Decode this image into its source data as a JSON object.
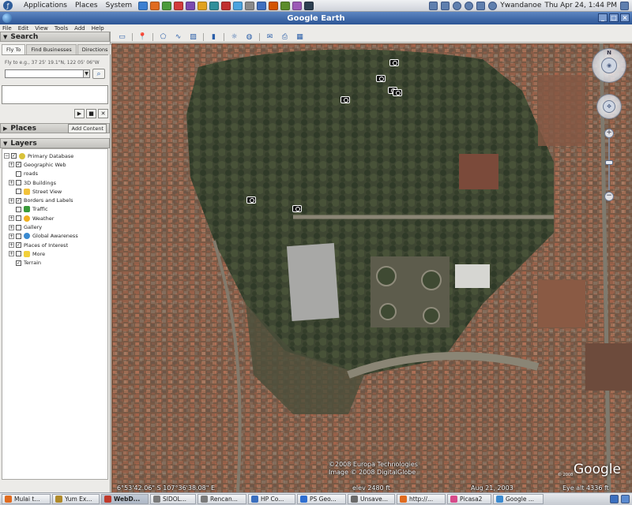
{
  "top_panel": {
    "menus": [
      "Applications",
      "Places",
      "System"
    ],
    "user": "Ywandanoe",
    "clock": "Thu Apr 24,  1:44 PM",
    "launcher_colors": [
      "#3b7fd1",
      "#e06b1f",
      "#4a9a3a",
      "#d13b3b",
      "#7a4ab0",
      "#e0a21f",
      "#2f8f9a",
      "#c03030",
      "#4aa3df",
      "#8a8a8a",
      "#3f6fbf",
      "#d35400",
      "#5b8c2a",
      "#9b59b6",
      "#2c3e50"
    ]
  },
  "window": {
    "title": "Google Earth",
    "controls": [
      "_",
      "□",
      "×"
    ]
  },
  "menubar": [
    "File",
    "Edit",
    "View",
    "Tools",
    "Add",
    "Help"
  ],
  "toolbar": {
    "icons": [
      "sidebar-icon",
      "placemark-icon",
      "polygon-icon",
      "path-icon",
      "image-overlay-icon",
      "ruler-icon",
      "sun-icon",
      "planets-icon",
      "email-icon",
      "print-icon",
      "maps-icon"
    ]
  },
  "search": {
    "header": "Search",
    "tabs": [
      "Fly To",
      "Find Businesses",
      "Directions"
    ],
    "hint": "Fly to e.g., 37 25' 19.1\"N, 122 05' 06\"W",
    "input_value": "",
    "go_icon": "magnifier-icon"
  },
  "places": {
    "header": "Places",
    "add_content": "Add Content"
  },
  "layers": {
    "header": "Layers",
    "items": [
      {
        "label": "Primary Database",
        "checked": true,
        "level": 0,
        "expand": "−",
        "icon": "globe-icon",
        "color": "#d8c23a"
      },
      {
        "label": "Geographic Web",
        "checked": true,
        "level": 1,
        "expand": "+",
        "icon": "",
        "color": ""
      },
      {
        "label": "roads",
        "checked": false,
        "level": 1,
        "expand": "",
        "icon": "",
        "color": ""
      },
      {
        "label": "3D Buildings",
        "checked": false,
        "level": 1,
        "expand": "+",
        "icon": "",
        "color": ""
      },
      {
        "label": "Street View",
        "checked": false,
        "level": 1,
        "expand": "",
        "icon": "person-icon",
        "color": "#f2c23a"
      },
      {
        "label": "Borders and Labels",
        "checked": true,
        "level": 1,
        "expand": "+",
        "icon": "",
        "color": ""
      },
      {
        "label": "Traffic",
        "checked": false,
        "level": 1,
        "expand": "",
        "icon": "traffic-light-icon",
        "color": "#3a9a3a"
      },
      {
        "label": "Weather",
        "checked": false,
        "level": 1,
        "expand": "+",
        "icon": "sun-icon",
        "color": "#f0b020"
      },
      {
        "label": "Gallery",
        "checked": false,
        "level": 1,
        "expand": "+",
        "icon": "",
        "color": ""
      },
      {
        "label": "Global Awareness",
        "checked": false,
        "level": 1,
        "expand": "+",
        "icon": "globe-icon",
        "color": "#3a8ad0"
      },
      {
        "label": "Places of Interest",
        "checked": true,
        "level": 1,
        "expand": "+",
        "icon": "",
        "color": ""
      },
      {
        "label": "More",
        "checked": false,
        "level": 1,
        "expand": "+",
        "icon": "folder-icon",
        "color": "#f2d03a"
      },
      {
        "label": "Terrain",
        "checked": true,
        "level": 1,
        "expand": "",
        "icon": "",
        "color": ""
      }
    ]
  },
  "map": {
    "copyright": [
      "©2008 Europa Technologies",
      "Image © 2008 DigitalGlobe"
    ],
    "coords": "6°53'42.06\" S   107°36'38.08\" E",
    "elev": "elev  2480 ft",
    "image_date": "Aug 21, 2003",
    "eye_alt": "Eye alt   4336 ft",
    "logo": "Google",
    "logo_sub": "© 2008",
    "nav_north": "N"
  },
  "taskbar": {
    "tasks": [
      {
        "label": "Mulai t...",
        "color": "#e06b1f",
        "active": false
      },
      {
        "label": "Yum Ex...",
        "color": "#b08a2a",
        "active": false
      },
      {
        "label": "WebD...",
        "color": "#c0392b",
        "active": true
      },
      {
        "label": "SIDOL...",
        "color": "#7a7a7a",
        "active": false
      },
      {
        "label": "Rencan...",
        "color": "#7a7a7a",
        "active": false
      },
      {
        "label": "HP Co...",
        "color": "#3a6fbf",
        "active": false
      },
      {
        "label": "PS Geo...",
        "color": "#2f6fd1",
        "active": false
      },
      {
        "label": "Unsave...",
        "color": "#6a6a6a",
        "active": false
      },
      {
        "label": "http://...",
        "color": "#e06b1f",
        "active": false
      },
      {
        "label": "Picasa2",
        "color": "#d84a8a",
        "active": false
      },
      {
        "label": "Google ...",
        "color": "#3a8ad0",
        "active": false
      }
    ],
    "tray_colors": [
      "#3a6fbf",
      "#5a8ad0"
    ]
  }
}
